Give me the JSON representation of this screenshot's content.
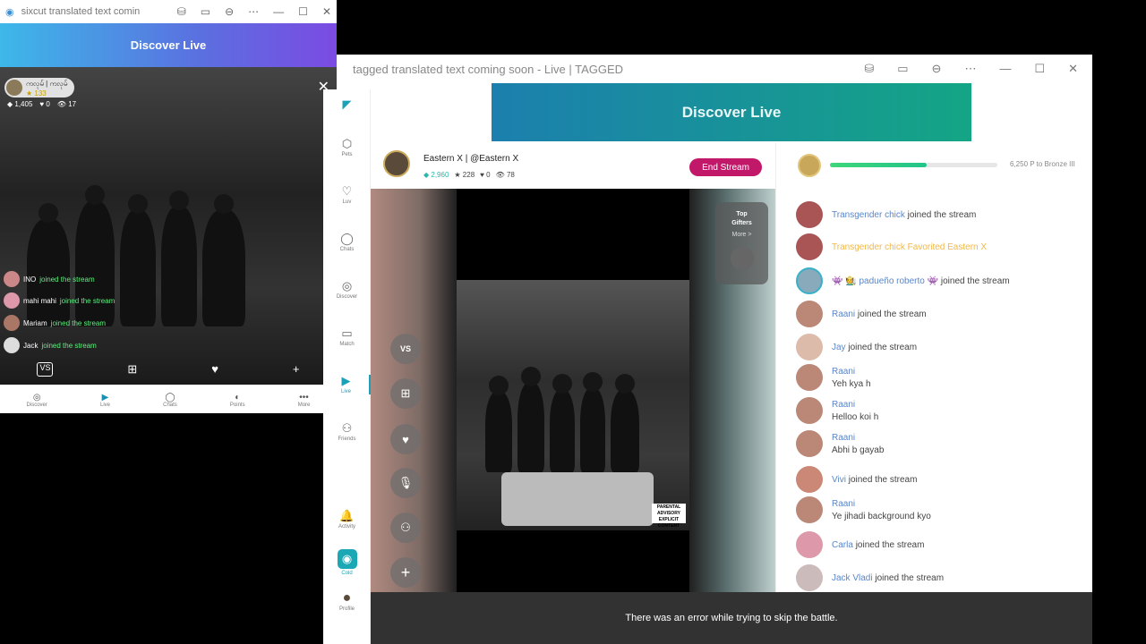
{
  "mini_window": {
    "title": "sixcut translated text comin",
    "header": "Discover Live",
    "host_name": "ကလုမ် | ကလုမ်",
    "host_points": "★ 133",
    "stats": [
      "◆ 1,405",
      "♥ 0",
      "👁 17"
    ],
    "chat": [
      {
        "user": "INO",
        "text": "joined the stream"
      },
      {
        "user": "mahi mahi",
        "text": "joined the stream"
      },
      {
        "user": "Mariam",
        "text": "joined the stream"
      },
      {
        "user": "Jack",
        "text": "joined the stream"
      }
    ],
    "nav": [
      {
        "icon": "◎",
        "label": "Discover"
      },
      {
        "icon": "▶",
        "label": "Live"
      },
      {
        "icon": "◯",
        "label": "Chats"
      },
      {
        "icon": "◐",
        "label": "Points"
      },
      {
        "icon": "•••",
        "label": "More"
      }
    ]
  },
  "sidebar": {
    "items": [
      {
        "icon": "⬡",
        "label": "Pets"
      },
      {
        "icon": "♡",
        "label": "Luv"
      },
      {
        "icon": "◯",
        "label": "Chats"
      },
      {
        "icon": "◎",
        "label": "Discover"
      },
      {
        "icon": "▭",
        "label": "Match"
      },
      {
        "icon": "▶",
        "label": "Live"
      },
      {
        "icon": "⚇",
        "label": "Friends"
      },
      {
        "icon": "🔔",
        "label": "Activity"
      },
      {
        "icon": "◉",
        "label": "Cold"
      },
      {
        "icon": "●",
        "label": "Profile"
      }
    ]
  },
  "main_window": {
    "title": "tagged translated text coming soon - Live | TAGGED",
    "banner": "Discover Live",
    "streamer": {
      "name": "Eastern X | @Eastern X",
      "stats": [
        "◆ 2,960",
        "★ 228",
        "♥ 0",
        "👁 78"
      ]
    },
    "end_stream_label": "End Stream",
    "top_gifters": {
      "title": "Top Gifters",
      "more": "More >"
    },
    "advisory": "PARENTAL ADVISORY EXPLICIT CONTENT",
    "progress_text": "6,250 P to Bronze III",
    "progress_fraction": 0.58,
    "messages": [
      {
        "user": "Transgender chick",
        "text": "joined the stream"
      },
      {
        "user": "Transgender chick",
        "text": "Favorited Eastern X",
        "fav": true
      },
      {
        "user": "👾 🧑‍🌾 padueño roberto 👾",
        "text": "joined the stream"
      },
      {
        "user": "Raani",
        "text": "joined the stream"
      },
      {
        "user": "Jay",
        "text": "joined the stream"
      },
      {
        "user": "Raani",
        "text": "Yeh kya h",
        "two_line": true
      },
      {
        "user": "Raani",
        "text": "Helloo koi h",
        "two_line": true
      },
      {
        "user": "Raani",
        "text": "Abhi b gayab",
        "two_line": true
      },
      {
        "user": "Vivi",
        "text": "joined the stream"
      },
      {
        "user": "Raani",
        "text": "Ye jihadi background kyo",
        "two_line": true
      },
      {
        "user": "Carla",
        "text": "joined the stream"
      },
      {
        "user": "Jack Vladi",
        "text": "joined the stream"
      }
    ]
  },
  "toast": "There was an error while trying to skip the battle.",
  "colors": {
    "accent": "#c2186a",
    "teal": "#14a585",
    "join_green": "#5ff080",
    "username": "#5a86c9",
    "fav": "#f0b84a"
  }
}
